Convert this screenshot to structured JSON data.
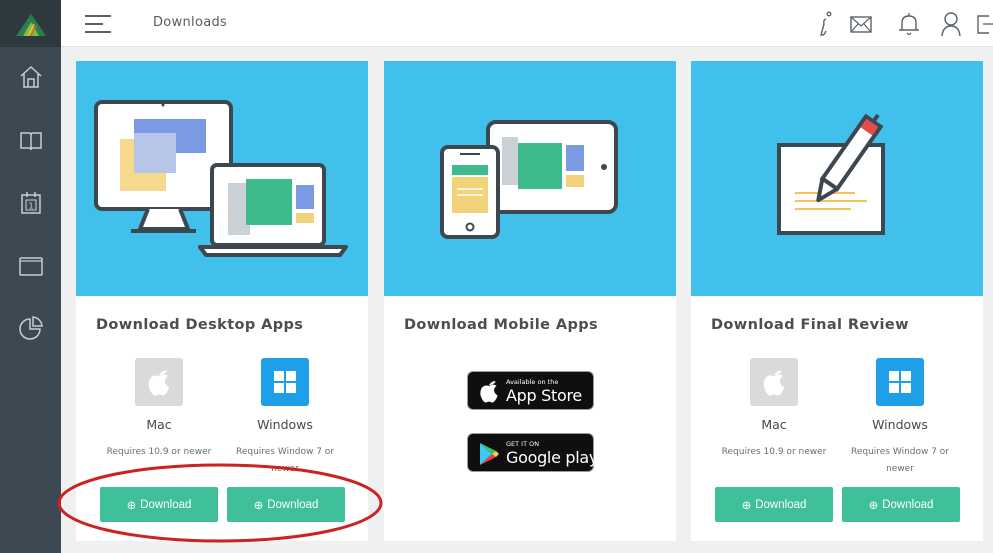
{
  "header": {
    "title": "Downloads"
  },
  "icons": {
    "sidebar": [
      "home-icon",
      "book-icon",
      "calendar-icon",
      "window-icon",
      "pie-chart-icon"
    ],
    "topbar": [
      "help-icon",
      "mail-icon",
      "bell-icon",
      "user-icon",
      "logout-icon"
    ]
  },
  "colors": {
    "sidebar": "#3c4952",
    "hero": "#40c0ea",
    "button": "#3fbf9a",
    "windows": "#1e9fe8",
    "annotation": "#cc2222"
  },
  "calendar_day": "1",
  "desktop": {
    "title": "Download Desktop Apps",
    "mac": {
      "name": "Mac",
      "req": "Requires 10.9 or newer"
    },
    "windows": {
      "name": "Windows",
      "req": "Requires Window 7 or newer"
    },
    "button_label": "Download",
    "button_icon": "⊕"
  },
  "mobile": {
    "title": "Download Mobile Apps",
    "appstore": {
      "small": "Available on the",
      "big": "App Store"
    },
    "googleplay": {
      "small": "GET IT ON",
      "big": "Google play"
    }
  },
  "final": {
    "title": "Download Final Review",
    "mac": {
      "name": "Mac",
      "req": "Requires 10.9 or newer"
    },
    "windows": {
      "name": "Windows",
      "req": "Requires Window 7 or newer"
    },
    "button_label": "Download",
    "button_icon": "⊕"
  }
}
